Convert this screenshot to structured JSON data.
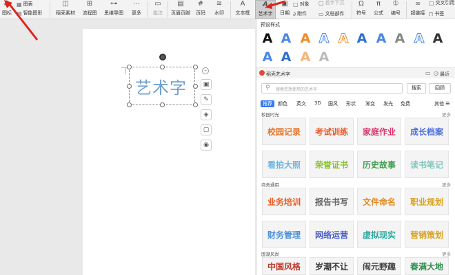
{
  "ribbon": {
    "items": [
      {
        "key": "chart",
        "label": "图表",
        "icon": "chart-icon"
      },
      {
        "key": "smartart",
        "label": "智能图形",
        "icon": "smartart-icon"
      },
      {
        "key": "icon-lib",
        "label": "图标",
        "icon": "icon-library-icon"
      },
      {
        "key": "sketch",
        "label": "稻壳素材",
        "icon": "materials-icon"
      },
      {
        "key": "flowchart",
        "label": "流程图",
        "icon": "flowchart-icon"
      },
      {
        "key": "mindmap",
        "label": "思维导图",
        "icon": "mindmap-icon"
      },
      {
        "key": "more",
        "label": "更多",
        "icon": "more-icon"
      },
      {
        "key": "comment",
        "label": "批注",
        "icon": "comment-icon"
      },
      {
        "key": "header-footer",
        "label": "页眉页脚",
        "icon": "header-footer-icon"
      },
      {
        "key": "page-number",
        "label": "页码",
        "icon": "page-number-icon"
      },
      {
        "key": "watermark",
        "label": "水印",
        "icon": "watermark-icon"
      },
      {
        "key": "textbox",
        "label": "文本框",
        "icon": "textbox-icon"
      },
      {
        "key": "wordart",
        "label": "艺术字",
        "icon": "wordart-icon"
      },
      {
        "key": "date",
        "label": "日期",
        "icon": "date-icon"
      },
      {
        "key": "attachment",
        "label": "附件",
        "icon": "attachment-icon"
      },
      {
        "key": "object",
        "label": "对象",
        "icon": "object-icon"
      },
      {
        "key": "first-sink",
        "label": "首字下沉",
        "icon": "drop-cap-icon"
      },
      {
        "key": "doc-parts",
        "label": "文档部件",
        "icon": "doc-parts-icon"
      },
      {
        "key": "symbol",
        "label": "符号",
        "icon": "omega-icon"
      },
      {
        "key": "formula",
        "label": "公式",
        "icon": "formula-icon"
      },
      {
        "key": "numbering",
        "label": "编号",
        "icon": "numbering-icon"
      },
      {
        "key": "hyperlink",
        "label": "超链接",
        "icon": "hyperlink-icon"
      },
      {
        "key": "crossref",
        "label": "交叉引用",
        "icon": "crossref-icon"
      },
      {
        "key": "bookmark",
        "label": "书签",
        "icon": "bookmark-icon"
      }
    ]
  },
  "document": {
    "wordart_text": "艺术字"
  },
  "panel": {
    "preset_title": "预设样式",
    "presets": [
      {
        "letter": "A",
        "color": "#111111",
        "style": "plain"
      },
      {
        "letter": "A",
        "color": "#4a86e8",
        "style": "plain"
      },
      {
        "letter": "A",
        "color": "#f08a24",
        "style": "plain"
      },
      {
        "letter": "A",
        "color": "#ffffff",
        "style": "outline-blue"
      },
      {
        "letter": "A",
        "color": "#ffffff",
        "style": "outline-orange"
      },
      {
        "letter": "A",
        "color": "#2f6fd0",
        "style": "plain"
      },
      {
        "letter": "A",
        "color": "#4a86e8",
        "style": "plain"
      },
      {
        "letter": "A",
        "color": "#888888",
        "style": "plain"
      },
      {
        "letter": "A",
        "color": "#ffffff",
        "style": "outline-blue"
      },
      {
        "letter": "A",
        "color": "#333333",
        "style": "plain"
      },
      {
        "letter": "A",
        "color": "#4a86e8",
        "style": "plain"
      },
      {
        "letter": "A",
        "color": "#2f6fd0",
        "style": "plain"
      },
      {
        "letter": "A",
        "color": "#f5b57a",
        "style": "plain"
      },
      {
        "letter": "A",
        "color": "#bbbbbb",
        "style": "plain"
      }
    ],
    "subhead_title": "稻壳艺术字",
    "recent_label": "最近",
    "search_placeholder": "搜索您想使用的艺术字",
    "search_btn": "搜索",
    "collapse_btn": "回顾",
    "categories": [
      "推荐",
      "颜色",
      "英文",
      "3D",
      "国风",
      "形状",
      "渐变",
      "发光",
      "免费"
    ],
    "others_label": "其他",
    "sections": [
      {
        "title": "校园时光",
        "more": "更多",
        "tiles": [
          {
            "text": "校园记录",
            "color": "#e8742a"
          },
          {
            "text": "考试训练",
            "color": "#e85a2a"
          },
          {
            "text": "家庭作业",
            "color": "#d9376e"
          },
          {
            "text": "成长档案",
            "color": "#4d6fd9"
          },
          {
            "text": "看拍大照",
            "color": "#6fb5e0"
          },
          {
            "text": "荣誉证书",
            "color": "#8fbf3a"
          },
          {
            "text": "历史故事",
            "color": "#3f9f4f"
          },
          {
            "text": "读书笔记",
            "color": "#7fc9c0"
          }
        ]
      },
      {
        "title": "商务通用",
        "more": "更多",
        "tiles": [
          {
            "text": "业务培训",
            "color": "#e85a1f"
          },
          {
            "text": "报告书写",
            "color": "#666666"
          },
          {
            "text": "文件命名",
            "color": "#e08a2a"
          },
          {
            "text": "职业规划",
            "color": "#d9a21f"
          },
          {
            "text": "财务管理",
            "color": "#4d8fd9"
          },
          {
            "text": "网络运营",
            "color": "#4a5fc9"
          },
          {
            "text": "虚拟现实",
            "color": "#2fa8a0"
          },
          {
            "text": "营销策划",
            "color": "#d9a21f"
          }
        ]
      },
      {
        "title": "国潮风尚",
        "more": "更多",
        "tiles": [
          {
            "text": "中国风格",
            "color": "#c0392b"
          },
          {
            "text": "岁潮不让",
            "color": "#333333"
          },
          {
            "text": "闹元野趣",
            "color": "#444444"
          },
          {
            "text": "春满大地",
            "color": "#2f8f4f"
          }
        ]
      }
    ]
  }
}
